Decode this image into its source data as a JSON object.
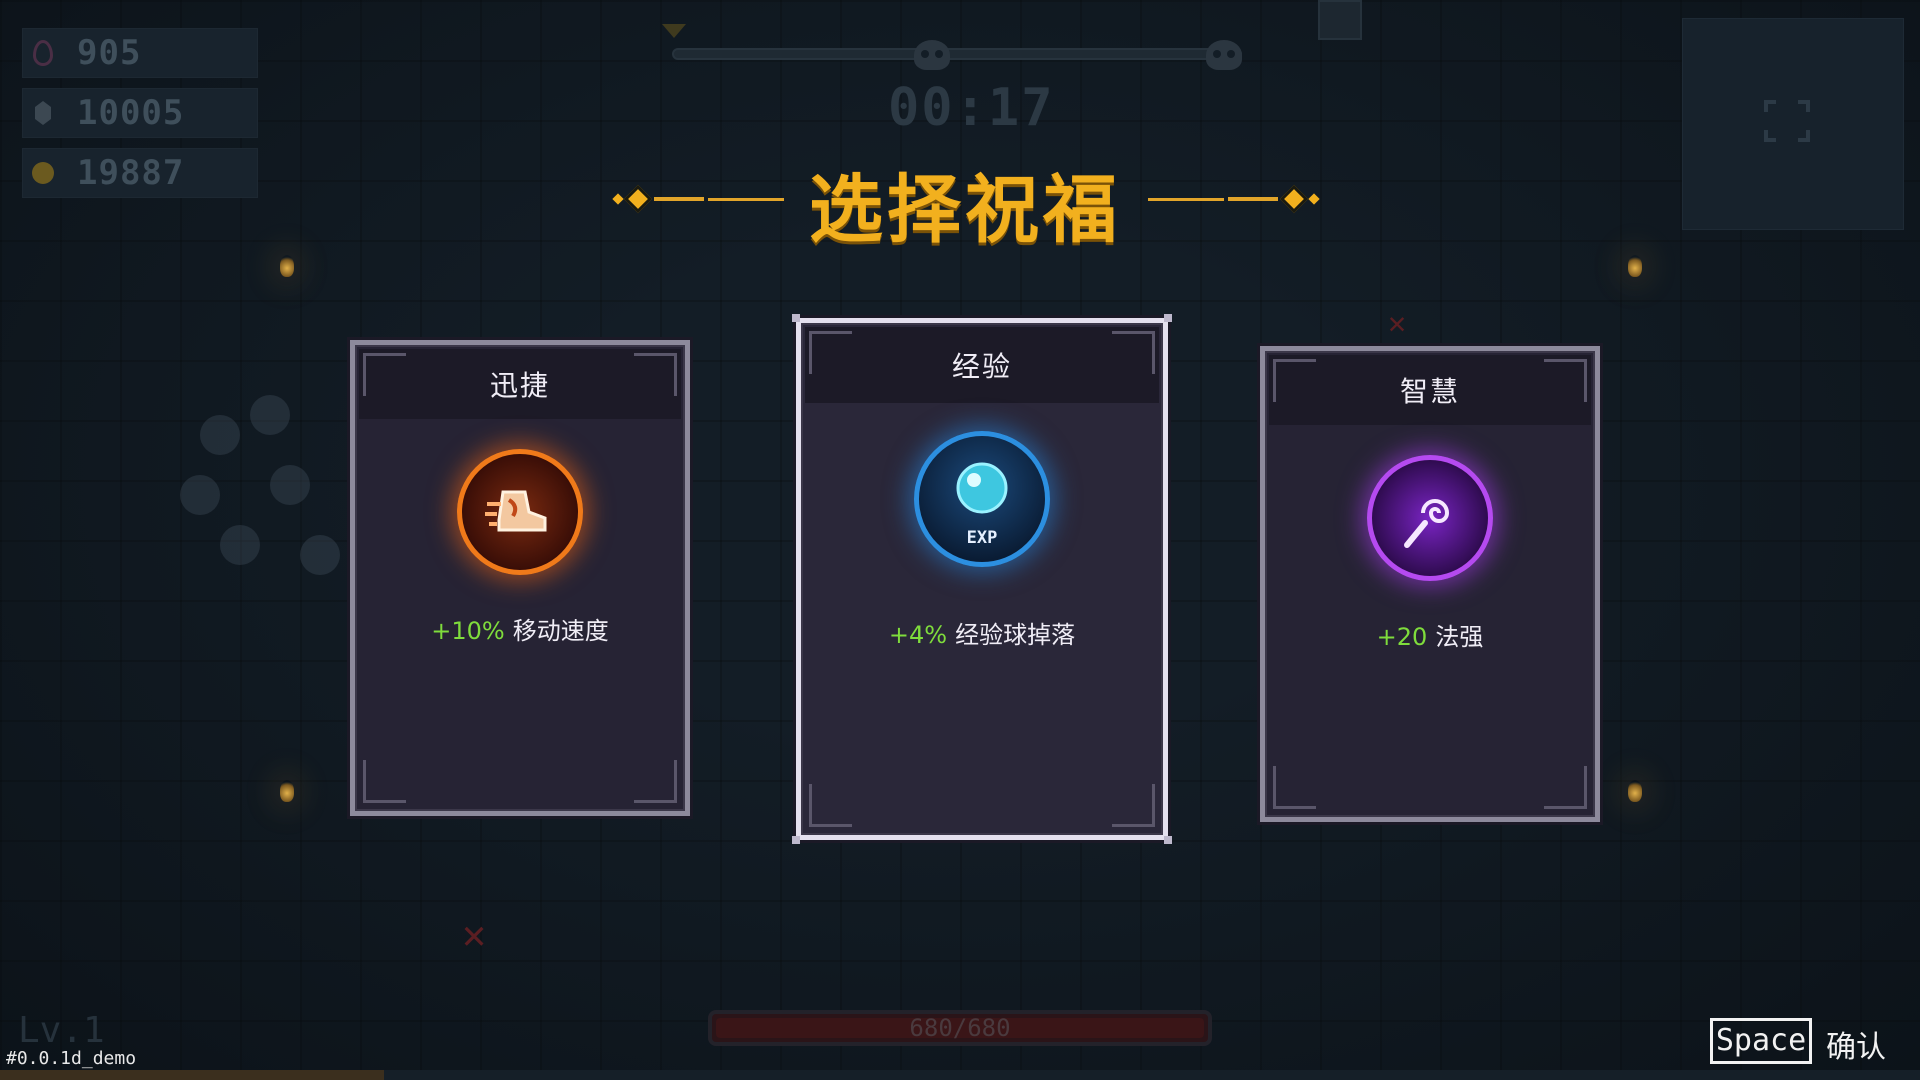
{
  "resources": {
    "souls": "905",
    "gems": "10005",
    "gold": "19887"
  },
  "hud": {
    "timer": "00:17",
    "level": "Lv.1",
    "hp": "680/680",
    "version": "#0.0.1d_demo",
    "xp_progress": 0.2
  },
  "title": "选择祝福",
  "cards": [
    {
      "name": "迅捷",
      "value": "+10%",
      "stat": "移动速度",
      "icon": "swift-boot-icon"
    },
    {
      "name": "经验",
      "value": "+4%",
      "stat": "经验球掉落",
      "icon": "exp-orb-icon",
      "icon_label": "EXP"
    },
    {
      "name": "智慧",
      "value": "+20",
      "stat": "法强",
      "icon": "magic-staff-icon"
    }
  ],
  "selected_card": 1,
  "confirm": {
    "key": "Space",
    "label": "确认"
  },
  "colors": {
    "title": "#f2b01e",
    "bonus_value": "#7fdc3c",
    "swift": "#f07a1a",
    "exp": "#2c8fe0",
    "wisdom": "#b54af0"
  }
}
